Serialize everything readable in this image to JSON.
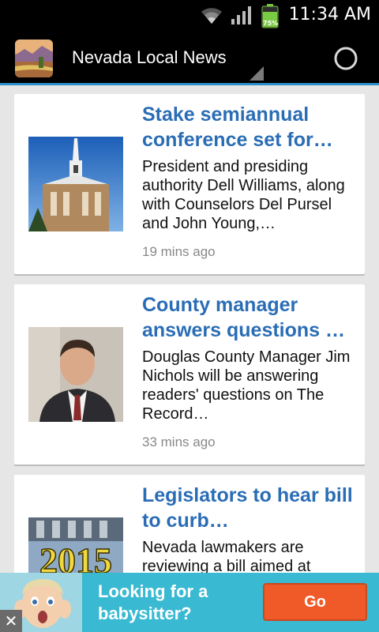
{
  "status_bar": {
    "time": "11:34 AM",
    "battery_percent": 75,
    "battery_label": "75%",
    "icons": [
      "wifi-icon",
      "signal-icon",
      "battery-icon"
    ]
  },
  "action_bar": {
    "title": "Nevada Local News",
    "icons": [
      "app-icon",
      "dropdown-indicator-icon",
      "refresh-icon"
    ],
    "accent_color": "#2b8fc9"
  },
  "articles": [
    {
      "title": "Stake semiannual conference set for…",
      "summary": "President and presiding authority Dell Williams, along with Counselors Del Pursel and John Young,…",
      "time": "19 mins ago",
      "thumbnail": "church-steeple-photo"
    },
    {
      "title": "County manager answers questions …",
      "summary": "Douglas County Manager Jim Nichols will be answering readers' questions on The Record…",
      "time": "33 mins ago",
      "thumbnail": "man-portrait-photo"
    },
    {
      "title": "Legislators to hear bill to curb…",
      "summary": "Nevada lawmakers are reviewing a bill aimed at",
      "time": "",
      "thumbnail": "2015-legislature-photo"
    }
  ],
  "ad": {
    "text": "Looking for a babysitter?",
    "button_label": "Go",
    "close_label": "✕",
    "background_color": "#39b9d2",
    "button_color": "#f05a28"
  },
  "colors": {
    "title_link": "#2a6db5",
    "timestamp": "#888888"
  }
}
